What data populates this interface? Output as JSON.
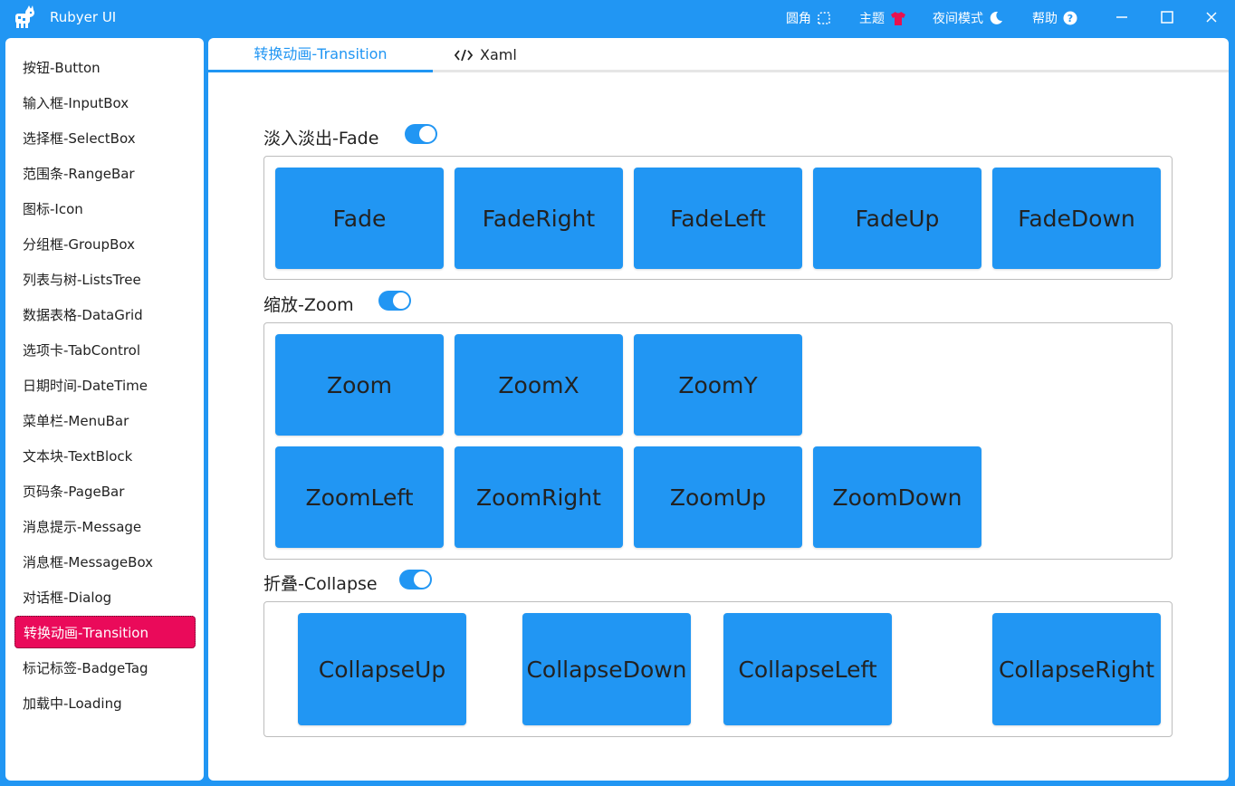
{
  "titlebar": {
    "app_title": "Rubyer UI",
    "corner_label": "圆角",
    "theme_label": "主题",
    "night_label": "夜间模式",
    "help_label": "帮助"
  },
  "sidebar": {
    "items": [
      {
        "label": "按钮-Button"
      },
      {
        "label": "输入框-InputBox"
      },
      {
        "label": "选择框-SelectBox"
      },
      {
        "label": "范围条-RangeBar"
      },
      {
        "label": "图标-Icon"
      },
      {
        "label": "分组框-GroupBox"
      },
      {
        "label": "列表与树-ListsTree"
      },
      {
        "label": "数据表格-DataGrid"
      },
      {
        "label": "选项卡-TabControl"
      },
      {
        "label": "日期时间-DateTime"
      },
      {
        "label": "菜单栏-MenuBar"
      },
      {
        "label": "文本块-TextBlock"
      },
      {
        "label": "页码条-PageBar"
      },
      {
        "label": "消息提示-Message"
      },
      {
        "label": "消息框-MessageBox"
      },
      {
        "label": "对话框-Dialog"
      },
      {
        "label": "转换动画-Transition",
        "active": true
      },
      {
        "label": "标记标签-BadgeTag"
      },
      {
        "label": "加载中-Loading"
      }
    ]
  },
  "tabs": {
    "transition": "转换动画-Transition",
    "xaml": "Xaml"
  },
  "sections": {
    "fade": {
      "label": "淡入淡出-Fade",
      "toggle_on": true,
      "buttons": [
        "Fade",
        "FadeRight",
        "FadeLeft",
        "FadeUp",
        "FadeDown"
      ]
    },
    "zoom": {
      "label": "缩放-Zoom",
      "toggle_on": true,
      "buttons": [
        "Zoom",
        "ZoomX",
        "ZoomY",
        "ZoomLeft",
        "ZoomRight",
        "ZoomUp",
        "ZoomDown"
      ]
    },
    "collapse": {
      "label": "折叠-Collapse",
      "toggle_on": true,
      "buttons": [
        "CollapseUp",
        "CollapseDown",
        "CollapseLeft",
        "CollapseRight"
      ]
    }
  },
  "colors": {
    "primary": "#2196F3",
    "active_nav": "#EA0A5A",
    "theme_icon": "#E8114F"
  }
}
